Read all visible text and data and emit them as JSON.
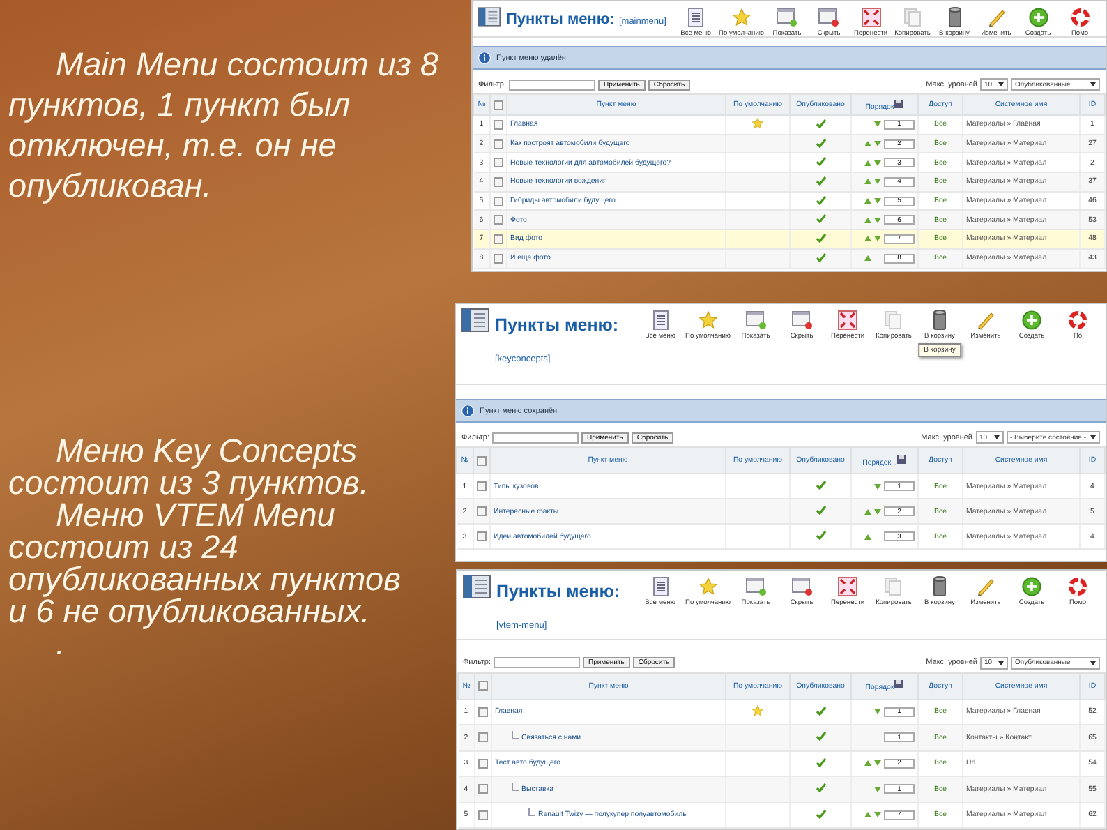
{
  "slide_text": [
    {
      "paragraphs": [
        "Main Menu состоит из 8 пунктов, 1 пункт был отключен, т.е. он не опубликован."
      ]
    },
    {
      "paragraphs": [
        "Меню Key Concepts состоит из 3 пунктов.",
        "Меню VTEM Menu состоит из 24 опубликованных пунктов и 6 не опубликованных.",
        "."
      ]
    }
  ],
  "screenshots": [
    {
      "title": "Пункты меню:",
      "menu_name": "[mainmenu]",
      "toolbar": [
        {
          "kind": "list",
          "label": "Все меню"
        },
        {
          "kind": "default",
          "label": "По умолчанию"
        },
        {
          "kind": "publish",
          "label": "Показать"
        },
        {
          "kind": "unpublish",
          "label": "Скрыть"
        },
        {
          "kind": "move",
          "label": "Перенести"
        },
        {
          "kind": "copy",
          "label": "Копировать"
        },
        {
          "kind": "trash",
          "label": "В корзину"
        },
        {
          "kind": "edit",
          "label": "Изменить"
        },
        {
          "kind": "new",
          "label": "Создать"
        },
        {
          "kind": "help",
          "label": "Помо"
        }
      ],
      "message": "Пункт меню удалён",
      "filter": {
        "label": "Фильтр:",
        "apply": "Применить",
        "reset": "Сбросить",
        "levels_label": "Макс. уровней",
        "levels": "10",
        "state": "Опубликованные"
      },
      "columns": [
        {
          "kind": "num",
          "label": "№"
        },
        {
          "kind": "check",
          "checked": false
        },
        {
          "kind": "name",
          "label": "Пункт меню"
        },
        {
          "kind": "default",
          "label": "По умолчанию"
        },
        {
          "kind": "published",
          "label": "Опубликовано"
        },
        {
          "kind": "order",
          "label": "Порядок"
        },
        {
          "kind": "access",
          "label": "Доступ"
        },
        {
          "kind": "system",
          "label": "Системное имя"
        },
        {
          "kind": "id",
          "label": "ID"
        }
      ],
      "rows": [
        {
          "number": "1",
          "checked": false,
          "name": "Главная",
          "default": true,
          "published": true,
          "up": false,
          "down": true,
          "order": "1",
          "access": "Все",
          "system": "Материалы » Главная",
          "id": "1",
          "selected": false
        },
        {
          "number": "2",
          "checked": false,
          "name": "Как построят автомобили будущего",
          "default": false,
          "published": true,
          "up": true,
          "down": true,
          "order": "2",
          "access": "Все",
          "system": "Материалы » Материал",
          "id": "27",
          "selected": false
        },
        {
          "number": "3",
          "checked": false,
          "name": "Новые технологии для автомобилей будущего?",
          "default": false,
          "published": true,
          "up": true,
          "down": true,
          "order": "3",
          "access": "Все",
          "system": "Материалы » Материал",
          "id": "2",
          "selected": false
        },
        {
          "number": "4",
          "checked": false,
          "name": "Новые технологии вождения",
          "default": false,
          "published": true,
          "up": true,
          "down": true,
          "order": "4",
          "access": "Все",
          "system": "Материалы » Материал",
          "id": "37",
          "selected": false
        },
        {
          "number": "5",
          "checked": false,
          "name": "Гибриды автомобили будущего",
          "default": false,
          "published": true,
          "up": true,
          "down": true,
          "order": "5",
          "access": "Все",
          "system": "Материалы » Материал",
          "id": "46",
          "selected": false
        },
        {
          "number": "6",
          "checked": false,
          "name": "Фото",
          "default": false,
          "published": true,
          "up": true,
          "down": true,
          "order": "6",
          "access": "Все",
          "system": "Материалы » Материал",
          "id": "53",
          "selected": false
        },
        {
          "number": "7",
          "checked": false,
          "name": "Вид фото",
          "default": false,
          "published": true,
          "up": true,
          "down": true,
          "order": "7",
          "access": "Все",
          "system": "Материалы » Материал",
          "id": "48",
          "selected": true
        },
        {
          "number": "8",
          "checked": false,
          "name": "И еще фото",
          "default": false,
          "published": true,
          "up": true,
          "down": false,
          "order": "8",
          "access": "Все",
          "system": "Материалы » Материал",
          "id": "43",
          "selected": false
        }
      ]
    },
    {
      "title": "Пункты меню:",
      "menu_name": "[keyconcepts]",
      "toolbar": [
        {
          "kind": "list",
          "label": "Все меню"
        },
        {
          "kind": "default",
          "label": "По умолчанию"
        },
        {
          "kind": "publish",
          "label": "Показать"
        },
        {
          "kind": "unpublish",
          "label": "Скрыть"
        },
        {
          "kind": "move",
          "label": "Перенести"
        },
        {
          "kind": "copy",
          "label": "Копировать"
        },
        {
          "kind": "trash",
          "label": "В корзину",
          "tooltip": "В корзину"
        },
        {
          "kind": "edit",
          "label": "Изменить"
        },
        {
          "kind": "new",
          "label": "Создать"
        },
        {
          "kind": "help",
          "label": "По"
        }
      ],
      "message": "Пункт меню сохранён",
      "filter": {
        "label": "Фильтр:",
        "apply": "Применить",
        "reset": "Сбросить",
        "levels_label": "Макс. уровней",
        "levels": "10",
        "state": "- Выберите состояние -"
      },
      "columns": [
        {
          "kind": "num",
          "label": "№"
        },
        {
          "kind": "check",
          "checked": false
        },
        {
          "kind": "name",
          "label": "Пункт меню"
        },
        {
          "kind": "default",
          "label": "По умолчанию"
        },
        {
          "kind": "published",
          "label": "Опубликовано"
        },
        {
          "kind": "order",
          "label": "Порядок..."
        },
        {
          "kind": "access",
          "label": "Доступ"
        },
        {
          "kind": "system",
          "label": "Системное имя"
        },
        {
          "kind": "id",
          "label": "ID"
        }
      ],
      "rows": [
        {
          "number": "1",
          "checked": false,
          "name": "Типы кузовов",
          "default": false,
          "published": true,
          "up": false,
          "down": true,
          "order": "1",
          "access": "Все",
          "system": "Материалы » Материал",
          "id": "4",
          "selected": false
        },
        {
          "number": "2",
          "checked": false,
          "name": "Интересные факты",
          "default": false,
          "published": true,
          "up": true,
          "down": true,
          "order": "2",
          "access": "Все",
          "system": "Материалы » Материал",
          "id": "5",
          "selected": false
        },
        {
          "number": "3",
          "checked": false,
          "name": "Идеи автомобилей будущего",
          "default": false,
          "published": true,
          "up": true,
          "down": false,
          "order": "3",
          "access": "Все",
          "system": "Материалы » Материал",
          "id": "4",
          "selected": false
        }
      ]
    },
    {
      "title": "Пункты меню:",
      "menu_name": "[vtem-menu]",
      "toolbar": [
        {
          "kind": "list",
          "label": "Все меню"
        },
        {
          "kind": "default",
          "label": "По умолчанию"
        },
        {
          "kind": "publish",
          "label": "Показать"
        },
        {
          "kind": "unpublish",
          "label": "Скрыть"
        },
        {
          "kind": "move",
          "label": "Перенести"
        },
        {
          "kind": "copy",
          "label": "Копировать"
        },
        {
          "kind": "trash",
          "label": "В корзину"
        },
        {
          "kind": "edit",
          "label": "Изменить"
        },
        {
          "kind": "new",
          "label": "Создать"
        },
        {
          "kind": "help",
          "label": "Помо"
        }
      ],
      "filter": {
        "label": "Фильтр:",
        "apply": "Применить",
        "reset": "Сбросить",
        "levels_label": "Макс. уровней",
        "levels": "10",
        "state": "Опубликованные"
      },
      "columns": [
        {
          "kind": "num",
          "label": "№"
        },
        {
          "kind": "check",
          "checked": false
        },
        {
          "kind": "name",
          "label": "Пункт меню"
        },
        {
          "kind": "default",
          "label": "По умолчанию"
        },
        {
          "kind": "published",
          "label": "Опубликовано"
        },
        {
          "kind": "order",
          "label": "Порядок"
        },
        {
          "kind": "access",
          "label": "Доступ"
        },
        {
          "kind": "system",
          "label": "Системное имя"
        },
        {
          "kind": "id",
          "label": "ID"
        }
      ],
      "rows": [
        {
          "number": "1",
          "checked": false,
          "name": "Главная",
          "default": true,
          "published": true,
          "up": false,
          "down": true,
          "order": "1",
          "access": "Все",
          "system": "Материалы » Главная",
          "id": "52",
          "selected": false,
          "children": [
            {
              "number": "2",
              "checked": false,
              "name": "Связаться с нами",
              "default": false,
              "published": true,
              "up": false,
              "down": false,
              "order": "1",
              "access": "Все",
              "system": "Контакты » Контакт",
              "id": "65",
              "selected": false
            }
          ]
        },
        {
          "number": "3",
          "checked": false,
          "name": "Тест авто будущего",
          "default": false,
          "published": true,
          "up": true,
          "down": true,
          "order": "2",
          "access": "Все",
          "system": "Url",
          "id": "54",
          "selected": false,
          "children": [
            {
              "number": "4",
              "checked": false,
              "name": "Выставка",
              "default": false,
              "published": true,
              "up": false,
              "down": true,
              "order": "1",
              "access": "Все",
              "system": "Материалы » Материал",
              "id": "55",
              "selected": false,
              "children": [
                {
                  "number": "5",
                  "checked": false,
                  "name": "Renault Twizy — полукупер полуавтомобиль",
                  "default": false,
                  "published": true,
                  "up": true,
                  "down": true,
                  "order": "7",
                  "access": "Все",
                  "system": "Материалы » Материал",
                  "id": "62",
                  "selected": false
                }
              ]
            }
          ]
        }
      ]
    }
  ]
}
